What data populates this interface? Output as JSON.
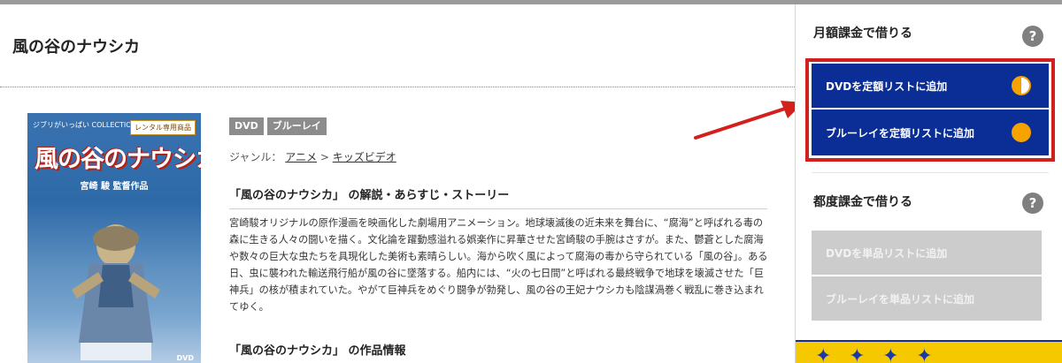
{
  "product": {
    "title": "風の谷のナウシカ",
    "cover": {
      "series_text": "ジブリがいっぱい COLLECTION",
      "rental_badge": "レンタル専用商品",
      "title": "風の谷のナウシカ",
      "subtitle": "宮崎 駿 監督作品",
      "format_mark": "DVD"
    },
    "tags": [
      "DVD",
      "ブルーレイ"
    ],
    "genre": {
      "label": "ジャンル：",
      "path": [
        "アニメ",
        "キッズビデオ"
      ],
      "separator": ">"
    },
    "story_heading": "「風の谷のナウシカ」 の解説・あらすじ・ストーリー",
    "description": "宮崎駿オリジナルの原作漫画を映画化した劇場用アニメーション。地球壊滅後の近未来を舞台に、“腐海”と呼ばれる毒の森に生きる人々の闘いを描く。文化論を躍動感溢れる娯楽作に昇華させた宮崎駿の手腕はさすが。また、鬱蒼とした腐海や数々の巨大な虫たちを具現化した美術も素晴らしい。海から吹く風によって腐海の毒から守られている「風の谷」。ある日、虫に襲われた輸送飛行船が風の谷に墜落する。船内には、“火の七日間”と呼ばれる最終戦争で地球を壊滅させた「巨神兵」の核が積まれていた。やがて巨神兵をめぐり闘争が勃発し、風の谷の王妃ナウシカも陰謀渦巻く戦乱に巻き込まれてゆく。",
    "info_heading": "「風の谷のナウシカ」 の作品情報"
  },
  "sidebar": {
    "monthly_heading": "月額課金で借りる",
    "monthly_buttons": [
      {
        "label": "DVDを定額リストに追加",
        "indicator": "half-circle-icon"
      },
      {
        "label": "ブルーレイを定額リストに追加",
        "indicator": "full-circle-icon"
      }
    ],
    "per_rental_heading": "都度課金で借りる",
    "per_rental_buttons": [
      {
        "label": "DVDを単品リストに追加"
      },
      {
        "label": "ブルーレイを単品リストに追加"
      }
    ],
    "help_icon": "?"
  },
  "colors": {
    "button_blue": "#0b2d96",
    "indicator_orange": "#f6a300",
    "highlight_red": "#d2201c",
    "disabled_gray": "#cccccc"
  }
}
